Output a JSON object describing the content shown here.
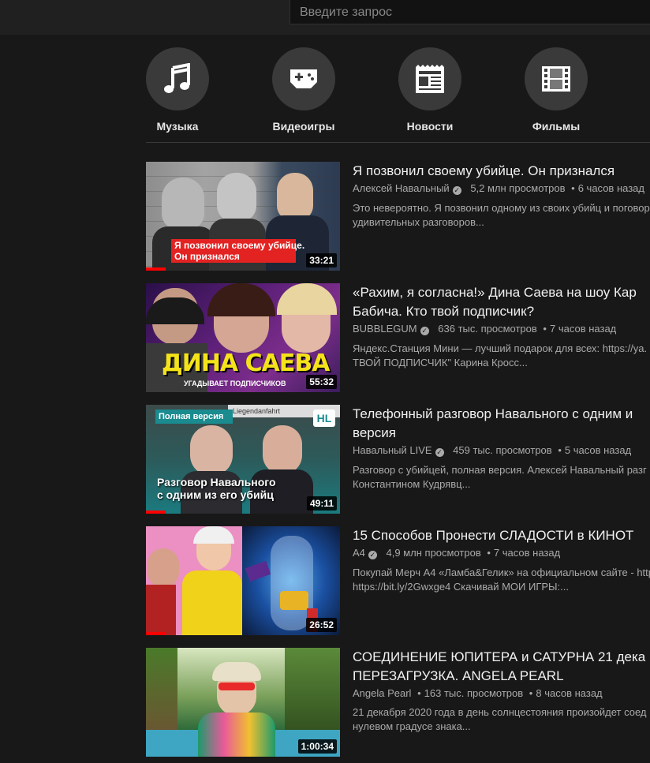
{
  "search": {
    "placeholder": "Введите запрос"
  },
  "categories": [
    {
      "label": "Музыка",
      "icon": "music-note-icon"
    },
    {
      "label": "Видеоигры",
      "icon": "gamepad-icon"
    },
    {
      "label": "Новости",
      "icon": "newspaper-icon"
    },
    {
      "label": "Фильмы",
      "icon": "film-strip-icon"
    }
  ],
  "videos": [
    {
      "title": "Я позвонил своему убийце. Он признался",
      "channel": "Алексей Навальный",
      "views": "5,2 млн просмотров",
      "age": "6 часов назад",
      "desc1": "Это невероятно. Я позвонил одному из своих убийц и поговорил",
      "desc2": "удивительных разговоров...",
      "duration": "33:21",
      "overlay1": "Я позвонил своему убийце.",
      "overlay2": "Он признался",
      "progress": 0.1
    },
    {
      "title1": "«Рахим, я согласна!» Дина Саева на шоу Кар",
      "title2": "Бабича. Кто твой подписчик?",
      "channel": "BUBBLEGUM",
      "views": "636 тыс. просмотров",
      "age": "7 часов назад",
      "desc1": "Яндекс.Станция Мини — лучший подарок для всех: https://ya.",
      "desc2": "ТВОЙ ПОДПИСЧИК\" Карина Кросс...",
      "duration": "55:32",
      "overlay1": "ДИНА САЕВА",
      "overlay2": "УГАДЫВАЕТ ПОДПИСЧИКОВ"
    },
    {
      "title1": "Телефонный разговор Навального с одним и",
      "title2": "версия",
      "channel": "Навальный LIVE",
      "views": "459 тыс. просмотров",
      "age": "5 часов назад",
      "desc1": "Разговор с убийцей, полная версия. Алексей Навальный разг",
      "desc2": "Константином Кудрявц...",
      "duration": "49:11",
      "overlay0": "Полная версия",
      "overlay1": "Разговор Навального",
      "overlay2": "с одним из его убийц",
      "sign": "Liegendanfahrt",
      "logo": "HL",
      "progress": 0.1
    },
    {
      "title": "15 Способов Пронести СЛАДОСТИ в КИНОТ",
      "channel": "А4",
      "views": "4,9 млн просмотров",
      "age": "7 часов назад",
      "desc1": "Покупай Мерч А4 «Ламба&Гелик» на официальном сайте - http",
      "desc2": "https://bit.ly/2Gwxge4 Скачивай МОИ ИГРЫ:...",
      "duration": "26:52",
      "progress": 0.1
    },
    {
      "title1": "СОЕДИНЕНИЕ ЮПИТЕРА и САТУРНА 21 дека",
      "title2": "ПЕРЕЗАГРУЗКА. ANGELA PEARL",
      "channel": "Angela Pearl",
      "views": "163 тыс. просмотров",
      "age": "8 часов назад",
      "desc1": "21 декабря 2020 года в день солнцестояния произойдет соед",
      "desc2": "нулевом градусе знака...",
      "duration": "1:00:34"
    }
  ]
}
